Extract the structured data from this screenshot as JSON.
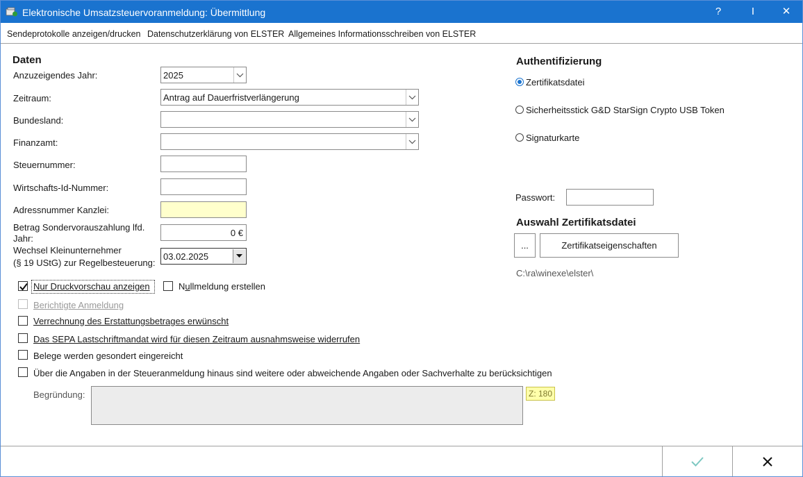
{
  "window": {
    "title": "Elektronische Umsatzsteuervoranmeldung: Übermittlung",
    "controls": {
      "help": "?",
      "pin": "I",
      "close": "✕"
    }
  },
  "menu": {
    "items": [
      "Sendeprotokolle anzeigen/drucken",
      "Datenschutzerklärung von ELSTER",
      "Allgemeines Informationsschreiben von ELSTER"
    ]
  },
  "daten": {
    "header": "Daten",
    "jahr_label": "Anzuzeigendes Jahr:",
    "jahr_value": "2025",
    "zeitraum_label": "Zeitraum:",
    "zeitraum_value": "Antrag auf Dauerfristverlängerung",
    "bundesland_label": "Bundesland:",
    "bundesland_value": "",
    "finanzamt_label": "Finanzamt:",
    "finanzamt_value": "",
    "steuernummer_label": "Steuernummer:",
    "steuernummer_value": "",
    "wirtschafts_label": "Wirtschafts-Id-Nummer:",
    "wirtschafts_value": "",
    "adressnummer_label": "Adressnummer Kanzlei:",
    "adressnummer_value": "",
    "betrag_label_1": "Betrag Sondervorauszahlung lfd.",
    "betrag_label_2": "Jahr:",
    "betrag_value": "0 €",
    "wechsel_label_1": "Wechsel Kleinunternehmer",
    "wechsel_label_2": "(§ 19 UStG) zur Regelbesteuerung:",
    "wechsel_value": "03.02.2025"
  },
  "options": {
    "druckvorschau": {
      "label": "Nur Druckvorschau anzeigen",
      "checked": true
    },
    "nullmeldung": {
      "label_pre": "N",
      "label_u": "u",
      "label_post": "llmeldung erstellen",
      "checked": false
    },
    "berichtigte": {
      "label": "Berichtigte Anmeldung",
      "checked": false,
      "disabled": true
    },
    "verrechnung": {
      "label": "Verrechnung des Erstattungsbetrages erwünscht",
      "checked": false
    },
    "sepa": {
      "label": "Das SEPA Lastschriftmandat wird für diesen Zeitraum ausnahmsweise widerrufen",
      "checked": false
    },
    "belege": {
      "label": "Belege werden gesondert eingereicht",
      "checked": false
    },
    "weitere": {
      "label": "Über die Angaben in der Steueranmeldung hinaus sind weitere oder abweichende Angaben oder Sachverhalte zu berücksichtigen",
      "checked": false
    }
  },
  "begruendung": {
    "label": "Begründung:",
    "value": "",
    "counter": "Z: 180"
  },
  "auth": {
    "header": "Authentifizierung",
    "options": [
      "Zertifikatsdatei",
      "Sicherheitsstick G&D StarSign Crypto USB Token",
      "Signaturkarte"
    ],
    "selected": "Zertifikatsdatei",
    "passwort_label": "Passwort:",
    "passwort_value": "",
    "zert_header": "Auswahl Zertifikatsdatei",
    "browse_label": "...",
    "eigenschaften_label": "Zertifikatseigenschaften",
    "path": "C:\\ra\\winexe\\elster\\"
  },
  "colors": {
    "titlebar": "#1a73cf",
    "check_ok": "#7ec8c2",
    "highlight_field": "#ffffcc"
  }
}
